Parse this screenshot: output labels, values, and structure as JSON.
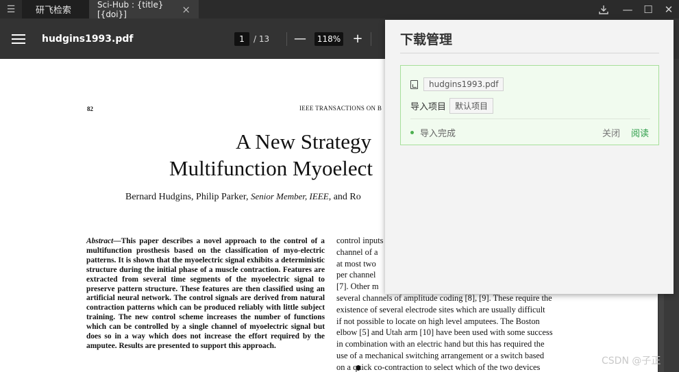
{
  "tabs": [
    {
      "label": "研飞检索"
    },
    {
      "label": "Sci-Hub : {title} [{doi}]"
    }
  ],
  "icons": {
    "menu": "list-icon",
    "tab_close": "×",
    "download": "download-icon",
    "minimize": "—",
    "maximize": "☐",
    "close": "✕"
  },
  "pdf_toolbar": {
    "filename": "hudgins1993.pdf",
    "page_current": "1",
    "page_total": "/ 13",
    "zoom": "118%",
    "zoom_out": "—",
    "zoom_in": "+"
  },
  "paper": {
    "page_number": "82",
    "journal_header": "IEEE TRANSACTIONS ON B",
    "title_line1": "A New Strategy",
    "title_line2": "Multifunction Myoelect",
    "authors_a": "Bernard Hudgins, Philip Parker, ",
    "authors_b": "Senior Member, IEEE",
    "authors_c": ", and Ro",
    "abstract_label": "Abstract",
    "abstract_text": "—This paper describes a novel approach to the control of a multifunction prosthesis based on the classification of myo-electric patterns. It is shown that the myoelectric signal exhibits a deterministic structure during the initial phase of a muscle contraction. Features are extracted from several time segments of the myoelectric signal to preserve pattern structure. These features are then classified using an artificial neural network. The control signals are derived from natural contraction patterns which can be produced reliably with little subject training. The new control scheme increases the number of functions which can be controlled by a single channel of myoelectric signal but does so in a way which does not increase the effort required by the amputee. Results are presented to support this approach.",
    "col2_lines": [
      "control inputs",
      "channel of a",
      "at most two",
      "per channel",
      "[7]. Other m",
      "several channels of amplitude coding [8], [9]. These require the",
      "existence of several electrode sites which are usually difficult",
      "if not possible to locate on high level amputees. The Boston",
      "elbow [5] and Utah arm [10] have been used with some success",
      "in combination with an electric hand but this has required the",
      "use of a mechanical switching arrangement or a switch based",
      "on a quick co-contraction to select which of the two devices"
    ]
  },
  "download_panel": {
    "title": "下载管理",
    "file_name": "hudgins1993.pdf",
    "import_label": "导入项目",
    "import_value": "默认项目",
    "status": "导入完成",
    "close_label": "关闭",
    "read_label": "阅读"
  },
  "watermark": "CSDN @子正",
  "colors": {
    "accent_green": "#2e9e4a",
    "card_border": "#a6df9a",
    "toolbar": "#333333"
  }
}
